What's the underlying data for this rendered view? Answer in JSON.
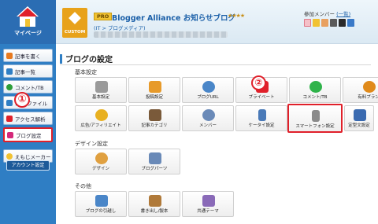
{
  "sidebar": {
    "mypage_label": "マイページ",
    "items": [
      {
        "label": "記事を書く",
        "icon": "pencil-icon",
        "color": "#e77a1f"
      },
      {
        "label": "記事一覧",
        "icon": "list-icon",
        "color": "#2f7ec4"
      },
      {
        "label": "コメント/TB",
        "icon": "comment-icon",
        "color": "#2e9e3a"
      },
      {
        "label": "ログ/ファイル",
        "icon": "file-icon",
        "color": "#2f7ec4"
      },
      {
        "label": "アクセス解析",
        "icon": "chart-icon",
        "color": "#e0202a"
      },
      {
        "label": "ブログ設定",
        "icon": "wrench-icon",
        "color": "#d4287a"
      },
      {
        "label": "えもじメーカー",
        "icon": "emoji-icon",
        "color": "#f1c232"
      }
    ],
    "account_button": "アカウント設定",
    "annotation_1": "①"
  },
  "header": {
    "pro_badge": "PRO",
    "blog_title": "Blogger Alliance お知らせブログ",
    "stars": "★★★★",
    "category": "(IT > ブログメディア)",
    "thumb_label": "CUSTOM",
    "members_label": "参加メンバー",
    "members_link": "(一覧)"
  },
  "main": {
    "page_title": "ブログの設定",
    "annotation_2": "②",
    "sections": {
      "basic": "基本設定",
      "design": "デザイン設定",
      "other": "その他"
    },
    "basic_tiles": [
      {
        "label": "基本設定",
        "icon": "page-icon",
        "color": "#9a9a9a"
      },
      {
        "label": "投稿設定",
        "icon": "pencil-icon",
        "color": "#e79a2a"
      },
      {
        "label": "ブログURL",
        "icon": "www-globe-icon",
        "color": "#4a86c8"
      },
      {
        "label": "プライベート",
        "icon": "lock-icon",
        "color": "#e0202a"
      },
      {
        "label": "コメント/TB",
        "icon": "comment-icon",
        "color": "#2fb34a"
      },
      {
        "label": "有料プラン",
        "icon": "coin-icon",
        "color": "#e08a1a"
      },
      {
        "label": "広告/アフィリエイト",
        "icon": "ad-icon",
        "color": "#e8b020"
      },
      {
        "label": "記事カテゴリ",
        "icon": "folder-icon",
        "color": "#7a5a3a"
      },
      {
        "label": "メンバー",
        "icon": "members-icon",
        "color": "#6a8ab8"
      },
      {
        "label": "ケータイ設定",
        "icon": "feature-phone-icon",
        "color": "#4a7ab8"
      },
      {
        "label": "スマートフォン設定",
        "icon": "smartphone-icon",
        "color": "#8a8a8a"
      },
      {
        "label": "定型文設定",
        "icon": "template-icon",
        "color": "#3a6ab0"
      }
    ],
    "design_tiles": [
      {
        "label": "デザイン",
        "icon": "palette-icon",
        "color": "#e0a040"
      },
      {
        "label": "ブログパーツ",
        "icon": "parts-icon",
        "color": "#6a8ab8"
      }
    ],
    "other_tiles": [
      {
        "label": "ブログの引越し",
        "icon": "truck-icon",
        "color": "#4a86c8"
      },
      {
        "label": "書き出し/製本",
        "icon": "book-icon",
        "color": "#b07a3a"
      },
      {
        "label": "共通テーマ",
        "icon": "theme-icon",
        "color": "#8a6ab8"
      }
    ]
  }
}
